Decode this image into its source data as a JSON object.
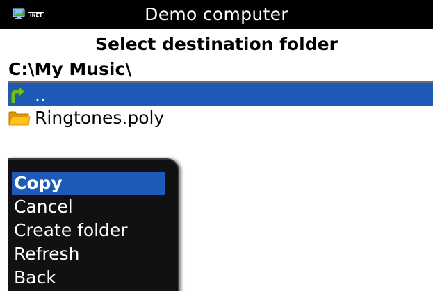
{
  "titlebar": {
    "title": "Demo computer",
    "status_icons": [
      "computer-icon",
      "inet-badge"
    ],
    "inet_label": "INET"
  },
  "dialog": {
    "heading": "Select destination folder",
    "current_path": "C:\\My Music\\"
  },
  "file_list": [
    {
      "icon": "up-folder-icon",
      "label": "..",
      "selected": true
    },
    {
      "icon": "folder-icon",
      "label": "Ringtones.poly",
      "selected": false
    }
  ],
  "context_menu": {
    "items": [
      {
        "label": "Copy",
        "selected": true
      },
      {
        "label": "Cancel",
        "selected": false
      },
      {
        "label": "Create folder",
        "selected": false
      },
      {
        "label": "Refresh",
        "selected": false
      },
      {
        "label": "Back",
        "selected": false
      }
    ]
  },
  "colors": {
    "selection": "#1e5ab8",
    "titlebar_bg": "#000000",
    "menu_bg": "#111111",
    "folder": "#f5b400",
    "up_arrow": "#6fbf2a"
  }
}
